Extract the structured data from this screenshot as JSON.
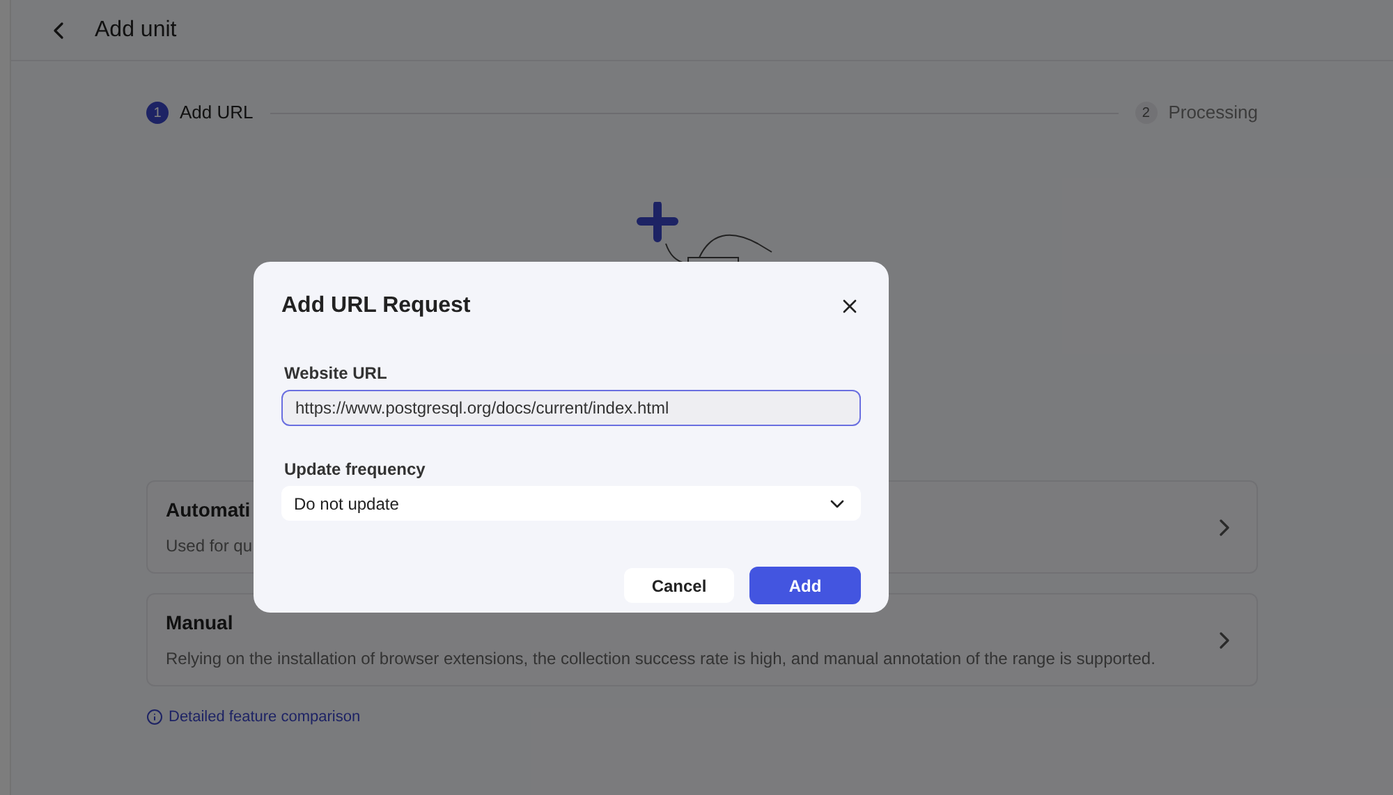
{
  "header": {
    "title": "Add unit"
  },
  "steps": [
    {
      "number": "1",
      "label": "Add URL",
      "selected": true
    },
    {
      "number": "2",
      "label": "Processing",
      "selected": false
    }
  ],
  "cards": [
    {
      "title": "Automati",
      "description": "Used for qu"
    },
    {
      "title": "Manual",
      "description": "Relying on the installation of browser extensions, the collection success rate is high, and manual annotation of the range is supported."
    }
  ],
  "comparison_link": "Detailed feature comparison",
  "dialog": {
    "title": "Add URL Request",
    "url_label": "Website URL",
    "url_value": "https://www.postgresql.org/docs/current/index.html",
    "frequency_label": "Update frequency",
    "frequency_value": "Do not update",
    "buttons": [
      {
        "label": "Cancel",
        "kind": "secondary"
      },
      {
        "label": "Add",
        "kind": "primary"
      }
    ]
  }
}
